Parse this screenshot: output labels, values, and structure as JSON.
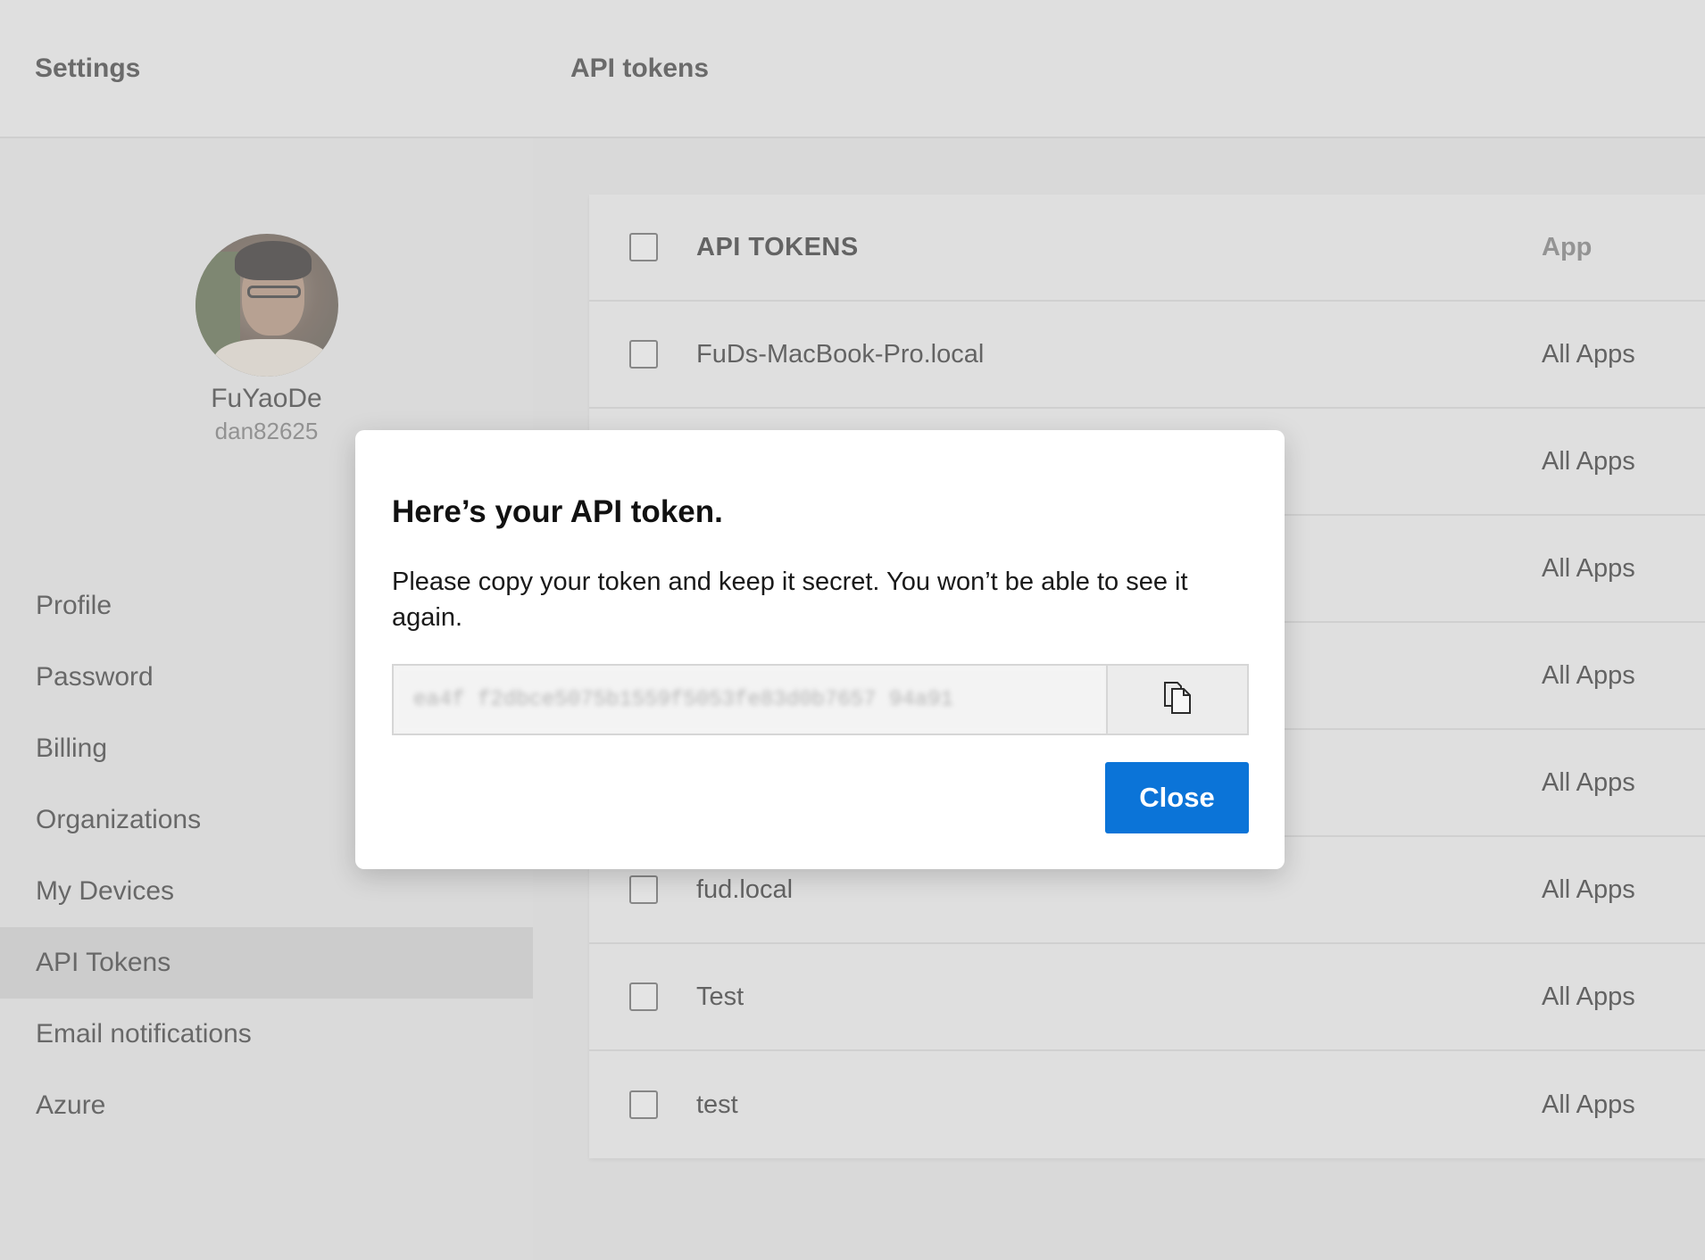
{
  "sidebar": {
    "title": "Settings",
    "user": {
      "name": "FuYaoDe",
      "handle": "dan82625"
    },
    "items": [
      {
        "label": "Profile"
      },
      {
        "label": "Password"
      },
      {
        "label": "Billing"
      },
      {
        "label": "Organizations"
      },
      {
        "label": "My Devices"
      },
      {
        "label": "API Tokens",
        "active": true
      },
      {
        "label": "Email notifications"
      },
      {
        "label": "Azure"
      }
    ]
  },
  "main": {
    "title": "API tokens",
    "table": {
      "columns": {
        "name": "API TOKENS",
        "app": "App"
      },
      "rows": [
        {
          "name": "FuDs-MacBook-Pro.local",
          "app": "All Apps"
        },
        {
          "name": "",
          "app": "All Apps"
        },
        {
          "name": "",
          "app": "All Apps"
        },
        {
          "name": "",
          "app": "All Apps"
        },
        {
          "name": "",
          "app": "All Apps"
        },
        {
          "name": "fud.local",
          "app": "All Apps"
        },
        {
          "name": "Test",
          "app": "All Apps"
        },
        {
          "name": "test",
          "app": "All Apps"
        }
      ]
    }
  },
  "dialog": {
    "title": "Here’s your API token.",
    "message": "Please copy your token and keep it secret. You won’t be able to see it again.",
    "token": "ea4f f2dbce5075b1559f5053fe83d0b7657 94a91",
    "close_label": "Close"
  },
  "colors": {
    "primary_button": "#0b74d8",
    "sidebar_active": "#c3c3c3"
  },
  "icons": {
    "copy": "copy-icon"
  }
}
